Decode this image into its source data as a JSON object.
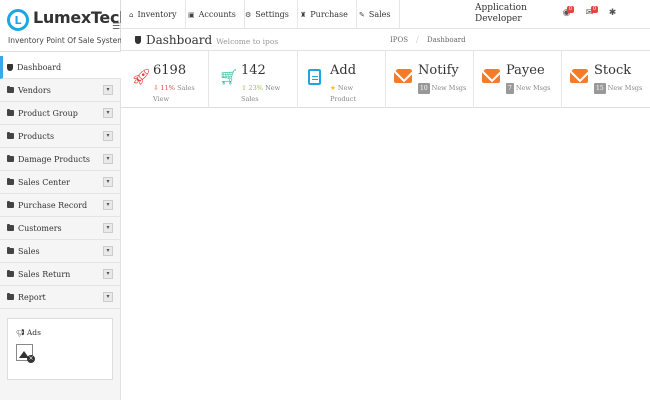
{
  "brand": {
    "logo_letter": "L",
    "name": "LumexTech",
    "tagline": "Inventory Point Of Sale System"
  },
  "topnav": {
    "items": [
      {
        "icon": "home-icon",
        "label": "Inventory"
      },
      {
        "icon": "money-icon",
        "label": "Accounts"
      },
      {
        "icon": "gears-icon",
        "label": "Settings"
      },
      {
        "icon": "trophy-icon",
        "label": "Purchase"
      },
      {
        "icon": "pen-icon",
        "label": "Sales"
      }
    ],
    "user_name": "Application Developer",
    "badges": {
      "globe": "0",
      "mail": "0"
    }
  },
  "sidebar": {
    "items": [
      {
        "label": "Dashboard",
        "active": true
      },
      {
        "label": "Vendors"
      },
      {
        "label": "Product Group"
      },
      {
        "label": "Products"
      },
      {
        "label": "Damage Products"
      },
      {
        "label": "Sales Center"
      },
      {
        "label": "Purchase Record"
      },
      {
        "label": "Customers"
      },
      {
        "label": "Sales"
      },
      {
        "label": "Sales Return"
      },
      {
        "label": "Report"
      }
    ],
    "ads_title": "Ads"
  },
  "page": {
    "title": "Dashboard",
    "subtitle": "Welcome to ipos",
    "breadcrumb": [
      "IPOS",
      "Dashboard"
    ]
  },
  "stats": [
    {
      "icon": "rocket-icon",
      "value": "6198",
      "pct": "11%",
      "sub": "Sales View",
      "color": "#e53935"
    },
    {
      "icon": "cart-icon",
      "value": "142",
      "pct": "23%",
      "sub": "New Sales",
      "color": "#2ebd9f"
    },
    {
      "icon": "document-icon",
      "value": "Add",
      "star": "★",
      "sub": "New Product",
      "color": "#1ba7e0"
    },
    {
      "icon": "envelope-icon",
      "value": "Notify",
      "count": "10",
      "sub": "New Msgs",
      "color": "#f47b2a"
    },
    {
      "icon": "envelope-icon",
      "value": "Payee",
      "count": "7",
      "sub": "New Msgs",
      "color": "#f47b2a"
    },
    {
      "icon": "envelope-icon",
      "value": "Stock",
      "count": "15",
      "sub": "New Msgs",
      "color": "#f47b2a"
    }
  ]
}
